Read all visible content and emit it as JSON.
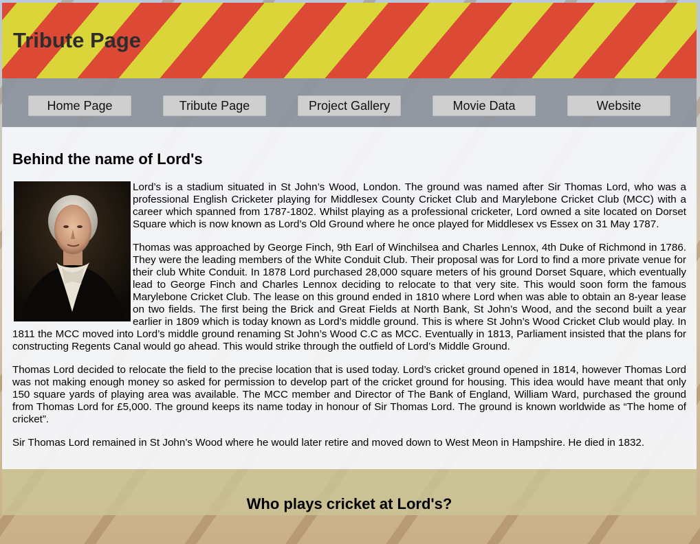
{
  "header": {
    "title": "Tribute Page"
  },
  "nav": {
    "items": [
      {
        "label": "Home Page"
      },
      {
        "label": "Tribute Page"
      },
      {
        "label": "Project Gallery"
      },
      {
        "label": "Movie Data"
      },
      {
        "label": "Website"
      }
    ]
  },
  "main": {
    "heading": "Behind the name of Lord's",
    "paragraphs": [
      "Lord’s is a stadium situated in St John’s Wood, London. The ground was named after Sir Thomas Lord, who was a professional English Cricketer playing for Middlesex County Cricket Club and Marylebone Cricket Club (MCC) with a career which spanned from 1787-1802. Whilst playing as a professional cricketer, Lord owned a site located on Dorset Square which is now known as Lord’s Old Ground where he once played for Middlesex vs Essex on 31 May 1787.",
      "Thomas was approached by George Finch, 9th Earl of Winchilsea and Charles Lennox, 4th Duke of Richmond in 1786. They were the leading members of the White Conduit Club. Their proposal was for Lord to find a more private venue for their club White Conduit. In 1878 Lord purchased 28,000 square meters of his ground Dorset Square, which eventually lead to George Finch and Charles Lennox deciding to relocate to that very site. This would soon form the famous Marylebone Cricket Club. The lease on this ground ended in 1810 where Lord when was able to obtain an 8-year lease on two fields. The first being the Brick and Great Fields at North Bank, St John’s Wood, and the second built a year earlier in 1809 which is today known as Lord’s middle ground. This is where St John’s Wood Cricket Club would play. In 1811 the MCC moved into Lord’s middle ground renaming St John’s Wood C.C as MCC. Eventually in 1813, Parliament insisted that the plans for constructing Regents Canal would go ahead. This would strike through the outfield of Lord’s Middle Ground.",
      "Thomas Lord decided to relocate the field to the precise location that is used today. Lord’s cricket ground opened in 1814, however Thomas Lord was not making enough money so asked for permission to develop part of the cricket ground for housing. This idea would have meant that only 150 square yards of playing area was available. The MCC member and Director of The Bank of England, William Ward, purchased the ground from Thomas Lord for £5,000. The ground keeps its name today in honour of Sir Thomas Lord. The ground is known worldwide as “The home of cricket”.",
      "Sir Thomas Lord remained in St John’s Wood where he would later retire and moved down to West Meon in Hampshire. He died in 1832."
    ]
  },
  "next_section": {
    "heading": "Who plays cricket at Lord's?"
  },
  "colors": {
    "stripe_red": "#dc4a36",
    "stripe_yellow": "#dad63a",
    "nav_bg": "#8c949e",
    "button_bg": "#cfcfcf"
  }
}
